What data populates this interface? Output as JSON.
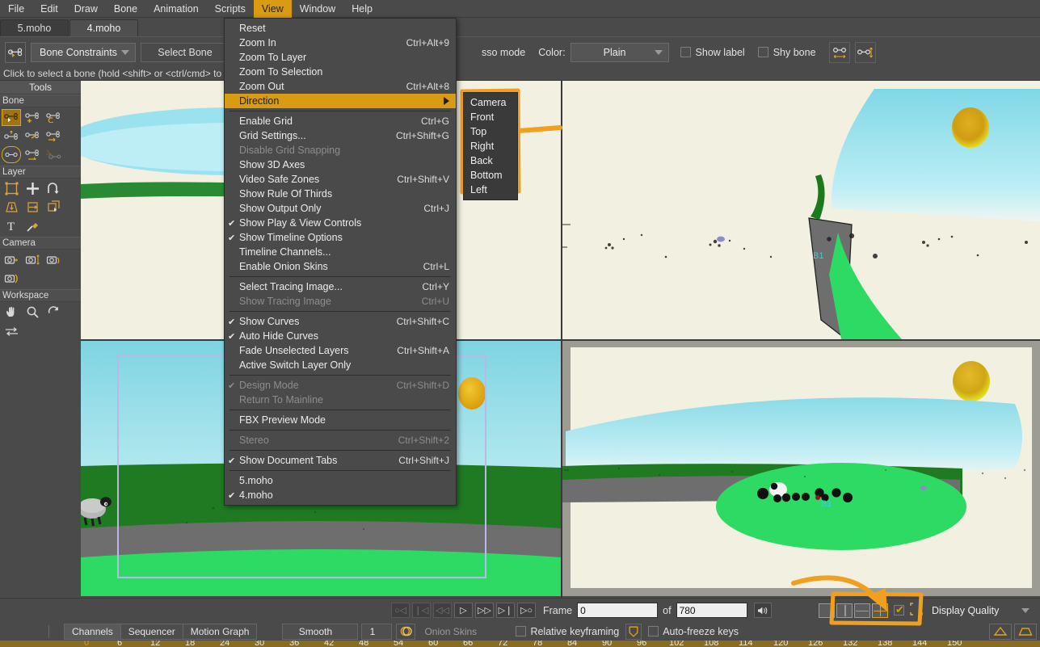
{
  "menubar": {
    "items": [
      {
        "label": "File",
        "active": false
      },
      {
        "label": "Edit",
        "active": false
      },
      {
        "label": "Draw",
        "active": false
      },
      {
        "label": "Bone",
        "active": false
      },
      {
        "label": "Animation",
        "active": false
      },
      {
        "label": "Scripts",
        "active": false
      },
      {
        "label": "View",
        "active": true
      },
      {
        "label": "Window",
        "active": false
      },
      {
        "label": "Help",
        "active": false
      }
    ]
  },
  "doctabs": {
    "tabs": [
      {
        "label": "5.moho",
        "selected": false
      },
      {
        "label": "4.moho",
        "selected": true
      }
    ]
  },
  "toolbar": {
    "bone_icon": "bone-select-icon",
    "constraints_label": "Bone Constraints",
    "select_bone_label": "Select Bone",
    "lasso_mode_label": "sso mode",
    "color_label": "Color:",
    "color_value": "Plain",
    "show_label_label": "Show label",
    "show_label_checked": false,
    "shy_bone_label": "Shy bone",
    "shy_bone_checked": false,
    "bone_width_icon": "bone-width-icon",
    "bone_height_icon": "bone-height-icon"
  },
  "hint": {
    "text": "Click to select a bone (hold <shift> or <ctrl/cmd> to"
  },
  "sidebar": {
    "title": "Tools",
    "groups": [
      {
        "name": "Bone",
        "tools": [
          {
            "name": "select-bone-tool",
            "state": "selected"
          },
          {
            "name": "add-bone-tool",
            "state": "normal"
          },
          {
            "name": "reparent-bone-tool",
            "state": "normal"
          },
          {
            "name": "bone-strength-tool",
            "state": "normal"
          },
          {
            "name": "manipulate-bones-tool",
            "state": "normal"
          },
          {
            "name": "offset-bone-tool",
            "state": "normal"
          },
          {
            "name": "bind-points-tool",
            "state": "ring"
          },
          {
            "name": "bind-layer-tool",
            "state": "normal"
          },
          {
            "name": "flexi-bind-tool",
            "state": "dim"
          }
        ]
      },
      {
        "name": "Layer",
        "tools": [
          {
            "name": "transform-layer-tool",
            "state": "normal"
          },
          {
            "name": "move-layer-tool",
            "state": "normal"
          },
          {
            "name": "rotate-layer-tool",
            "state": "normal"
          },
          {
            "name": "shear-layer-tool",
            "state": "normal"
          },
          {
            "name": "flip-layer-tool",
            "state": "normal"
          },
          {
            "name": "set-origin-tool",
            "state": "normal"
          },
          {
            "name": "text-tool",
            "state": "normal"
          },
          {
            "name": "eyedropper-tool",
            "state": "normal"
          }
        ]
      },
      {
        "name": "Camera",
        "tools": [
          {
            "name": "track-camera-tool",
            "state": "normal"
          },
          {
            "name": "zoom-camera-tool",
            "state": "normal"
          },
          {
            "name": "roll-camera-tool",
            "state": "normal"
          },
          {
            "name": "pan-tilt-camera-tool",
            "state": "normal"
          }
        ]
      },
      {
        "name": "Workspace",
        "tools": [
          {
            "name": "pan-tool",
            "state": "normal"
          },
          {
            "name": "zoom-tool",
            "state": "normal"
          },
          {
            "name": "rotate-workspace-tool",
            "state": "normal"
          },
          {
            "name": "orbit-workspace-tool",
            "state": "normal"
          }
        ]
      }
    ]
  },
  "view_menu": {
    "items": [
      {
        "label": "Reset",
        "accel": "",
        "checked": false,
        "disabled": false,
        "highlight": false,
        "submenu": false
      },
      {
        "label": "Zoom In",
        "accel": "Ctrl+Alt+9",
        "checked": false,
        "disabled": false,
        "highlight": false,
        "submenu": false
      },
      {
        "label": "Zoom To Layer",
        "accel": "",
        "checked": false,
        "disabled": false,
        "highlight": false,
        "submenu": false
      },
      {
        "label": "Zoom To Selection",
        "accel": "",
        "checked": false,
        "disabled": false,
        "highlight": false,
        "submenu": false
      },
      {
        "label": "Zoom Out",
        "accel": "Ctrl+Alt+8",
        "checked": false,
        "disabled": false,
        "highlight": false,
        "submenu": false
      },
      {
        "label": "Direction",
        "accel": "",
        "checked": false,
        "disabled": false,
        "highlight": true,
        "submenu": true
      },
      {
        "separator": true
      },
      {
        "label": "Enable Grid",
        "accel": "Ctrl+G",
        "checked": false,
        "disabled": false,
        "highlight": false,
        "submenu": false
      },
      {
        "label": "Grid Settings...",
        "accel": "Ctrl+Shift+G",
        "checked": false,
        "disabled": false,
        "highlight": false,
        "submenu": false
      },
      {
        "label": "Disable Grid Snapping",
        "accel": "",
        "checked": false,
        "disabled": true,
        "highlight": false,
        "submenu": false
      },
      {
        "label": "Show 3D Axes",
        "accel": "",
        "checked": false,
        "disabled": false,
        "highlight": false,
        "submenu": false
      },
      {
        "label": "Video Safe Zones",
        "accel": "Ctrl+Shift+V",
        "checked": false,
        "disabled": false,
        "highlight": false,
        "submenu": false
      },
      {
        "label": "Show Rule Of Thirds",
        "accel": "",
        "checked": false,
        "disabled": false,
        "highlight": false,
        "submenu": false
      },
      {
        "label": "Show Output Only",
        "accel": "Ctrl+J",
        "checked": false,
        "disabled": false,
        "highlight": false,
        "submenu": false
      },
      {
        "label": "Show Play & View Controls",
        "accel": "",
        "checked": true,
        "disabled": false,
        "highlight": false,
        "submenu": false
      },
      {
        "label": "Show Timeline Options",
        "accel": "",
        "checked": true,
        "disabled": false,
        "highlight": false,
        "submenu": false
      },
      {
        "label": "Timeline Channels...",
        "accel": "",
        "checked": false,
        "disabled": false,
        "highlight": false,
        "submenu": false
      },
      {
        "label": "Enable Onion Skins",
        "accel": "Ctrl+L",
        "checked": false,
        "disabled": false,
        "highlight": false,
        "submenu": false
      },
      {
        "separator": true
      },
      {
        "label": "Select Tracing Image...",
        "accel": "Ctrl+Y",
        "checked": false,
        "disabled": false,
        "highlight": false,
        "submenu": false
      },
      {
        "label": "Show Tracing Image",
        "accel": "Ctrl+U",
        "checked": false,
        "disabled": true,
        "highlight": false,
        "submenu": false
      },
      {
        "separator": true
      },
      {
        "label": "Show Curves",
        "accel": "Ctrl+Shift+C",
        "checked": true,
        "disabled": false,
        "highlight": false,
        "submenu": false
      },
      {
        "label": "Auto Hide Curves",
        "accel": "",
        "checked": true,
        "disabled": false,
        "highlight": false,
        "submenu": false
      },
      {
        "label": "Fade Unselected Layers",
        "accel": "Ctrl+Shift+A",
        "checked": false,
        "disabled": false,
        "highlight": false,
        "submenu": false
      },
      {
        "label": "Active Switch Layer Only",
        "accel": "",
        "checked": false,
        "disabled": false,
        "highlight": false,
        "submenu": false
      },
      {
        "separator": true
      },
      {
        "label": "Design Mode",
        "accel": "Ctrl+Shift+D",
        "checked": true,
        "disabled": true,
        "highlight": false,
        "submenu": false
      },
      {
        "label": "Return To Mainline",
        "accel": "",
        "checked": false,
        "disabled": true,
        "highlight": false,
        "submenu": false
      },
      {
        "separator": true
      },
      {
        "label": "FBX Preview Mode",
        "accel": "",
        "checked": false,
        "disabled": false,
        "highlight": false,
        "submenu": false
      },
      {
        "separator": true
      },
      {
        "label": "Stereo",
        "accel": "Ctrl+Shift+2",
        "checked": false,
        "disabled": true,
        "highlight": false,
        "submenu": false
      },
      {
        "separator": true
      },
      {
        "label": "Show Document Tabs",
        "accel": "Ctrl+Shift+J",
        "checked": true,
        "disabled": false,
        "highlight": false,
        "submenu": false
      },
      {
        "separator": true
      },
      {
        "label": "5.moho",
        "accel": "",
        "checked": false,
        "disabled": false,
        "highlight": false,
        "submenu": false
      },
      {
        "label": "4.moho",
        "accel": "",
        "checked": true,
        "disabled": false,
        "highlight": false,
        "submenu": false
      }
    ]
  },
  "direction_submenu": {
    "items": [
      {
        "label": "Camera"
      },
      {
        "label": "Front"
      },
      {
        "label": "Top"
      },
      {
        "label": "Right"
      },
      {
        "label": "Back"
      },
      {
        "label": "Bottom"
      },
      {
        "label": "Left"
      }
    ],
    "pointed_item": "Top"
  },
  "playbar": {
    "buttons": [
      {
        "name": "loop-start-button",
        "glyph": "○◁",
        "dim": true
      },
      {
        "name": "go-to-start-button",
        "glyph": "❘◁",
        "dim": true
      },
      {
        "name": "step-back-button",
        "glyph": "◁◁",
        "dim": true
      },
      {
        "name": "play-button",
        "glyph": "▷",
        "dim": false
      },
      {
        "name": "fast-forward-button",
        "glyph": "▷▷",
        "dim": false
      },
      {
        "name": "go-to-end-button",
        "glyph": "▷❘",
        "dim": false
      },
      {
        "name": "loop-end-button",
        "glyph": "▷○",
        "dim": false
      }
    ],
    "frame_label": "Frame",
    "frame_value": "0",
    "of_label": "of",
    "total_value": "780",
    "audio_icon": "speaker-icon",
    "layouts": [
      {
        "name": "layout-single",
        "selected": false
      },
      {
        "name": "layout-two-columns",
        "selected": false
      },
      {
        "name": "layout-three-pane",
        "selected": false
      },
      {
        "name": "layout-quad",
        "selected": true
      }
    ],
    "visible_checked": true,
    "bbox_icon": "bounding-box-icon",
    "display_quality_label": "Display Quality"
  },
  "timeline_bar": {
    "tabs": [
      {
        "label": "Channels",
        "selected": true
      },
      {
        "label": "Sequencer",
        "selected": false
      },
      {
        "label": "Motion Graph",
        "selected": false
      }
    ],
    "interp_value": "Smooth",
    "step_value": "1",
    "onion_icon": "onion-skin-icon",
    "onion_skins_label": "Onion Skins",
    "relative_keyframing_label": "Relative keyframing",
    "relative_keyframing_checked": false,
    "shield_icon": "shield-icon",
    "auto_freeze_label": "Auto-freeze keys",
    "auto_freeze_checked": false,
    "peak_icon": "peak-shape-icon",
    "plateau_icon": "plateau-shape-icon"
  },
  "ruler": {
    "ticks": [
      "0",
      "6",
      "12",
      "18",
      "24",
      "30",
      "36",
      "42",
      "48",
      "54",
      "60",
      "66",
      "72",
      "78",
      "84",
      "90",
      "96",
      "102",
      "108",
      "114",
      "120",
      "126",
      "132",
      "138",
      "144",
      "150"
    ]
  },
  "viewports": {
    "top_left": {
      "name": "viewport-top-left",
      "view": "front-hidden-behind-menu"
    },
    "top_right": {
      "name": "viewport-top-right",
      "view": "top",
      "bone_label": "B1"
    },
    "bottom_left": {
      "name": "viewport-bottom-left",
      "view": "camera",
      "bone_label": ""
    },
    "bottom_right": {
      "name": "viewport-bottom-right",
      "view": "top-angled",
      "bone_label": "B1"
    }
  },
  "annotations": {
    "submenu_box": "orange-highlight-box-around-direction-submenu",
    "submenu_arrow": "orange-arrow-pointing-to-top",
    "layout_box": "orange-highlight-box-around-view-layout-buttons",
    "layout_arrow": "orange-curved-arrow-pointing-to-layout-buttons",
    "color": "#f0a01e"
  },
  "colors": {
    "accent": "#d89b12",
    "panel": "#4a4a4a",
    "canvas": "#f2f0e1",
    "sky": "#7fdce8",
    "grass_dark": "#0f7a1e",
    "grass_light": "#2ddb64",
    "road": "#6b6b6b",
    "sun": "#d7a715",
    "annotation": "#f0a01e"
  }
}
